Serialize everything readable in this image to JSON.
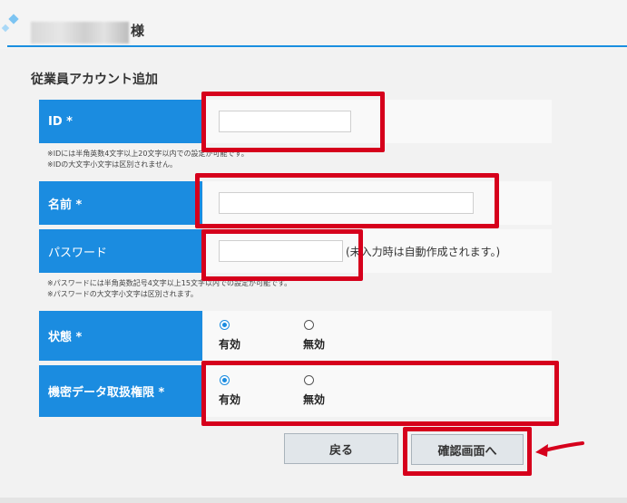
{
  "header": {
    "user_suffix": "様"
  },
  "page": {
    "title": "従業員アカウント追加"
  },
  "form": {
    "id": {
      "label": "ID *",
      "value": "",
      "notes": [
        "※IDには半角英数4文字以上20文字以内での設定が可能です。",
        "※IDの大文字小文字は区別されません。"
      ]
    },
    "name": {
      "label": "名前 *",
      "value": ""
    },
    "password": {
      "label": "パスワード",
      "value": "",
      "hint": "(未入力時は自動作成されます。)",
      "notes": [
        "※パスワードには半角英数記号4文字以上15文字以内での設定が可能です。",
        "※パスワードの大文字小文字は区別されます。"
      ]
    },
    "status": {
      "label": "状態 *",
      "options": [
        {
          "label": "有効",
          "checked": true
        },
        {
          "label": "無効",
          "checked": false
        }
      ]
    },
    "confidential": {
      "label": "機密データ取扱権限 *",
      "options": [
        {
          "label": "有効",
          "checked": true
        },
        {
          "label": "無効",
          "checked": false
        }
      ]
    }
  },
  "buttons": {
    "back": "戻る",
    "confirm": "確認画面へ"
  },
  "colors": {
    "label_bg": "#1b8ce0",
    "highlight": "#d6001c",
    "accent_line": "#1a8fe0"
  }
}
